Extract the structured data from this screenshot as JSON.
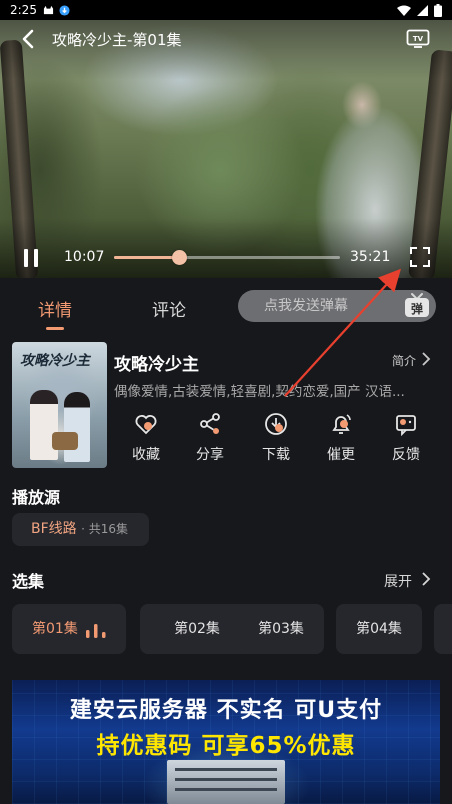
{
  "status_bar": {
    "time": "2:25"
  },
  "player": {
    "title": "攻略冷少主-第01集",
    "current_time": "10:07",
    "duration": "35:21",
    "progress": 0.286
  },
  "tabs": [
    {
      "label": "详情",
      "active": true
    },
    {
      "label": "评论",
      "active": false
    }
  ],
  "danmaku": {
    "placeholder": "点我发送弹幕",
    "icon_label": "弹"
  },
  "show": {
    "poster_title": "攻略冷少主",
    "title": "攻略冷少主",
    "intro_label": "简介",
    "tags": "偶像爱情,古装爱情,轻喜剧,契约恋爱,国产 汉语..."
  },
  "actions": [
    {
      "label": "收藏",
      "icon": "heart-icon"
    },
    {
      "label": "分享",
      "icon": "share-icon"
    },
    {
      "label": "下载",
      "icon": "download-icon"
    },
    {
      "label": "催更",
      "icon": "bell-icon"
    },
    {
      "label": "反馈",
      "icon": "feedback-icon"
    }
  ],
  "source": {
    "section_title": "播放源",
    "name": "BF线路",
    "count": "· 共16集"
  },
  "episodes": {
    "section_title": "选集",
    "expand_label": "展开",
    "items": [
      "第01集",
      "第02集",
      "第03集",
      "第04集"
    ]
  },
  "ad": {
    "line1": "建安云服务器 不实名 可U支付",
    "line2": "持优惠码 可享65%优惠"
  },
  "colors": {
    "accent": "#f29a72",
    "background": "#17181c",
    "annotation_arrow": "#e8402e"
  }
}
